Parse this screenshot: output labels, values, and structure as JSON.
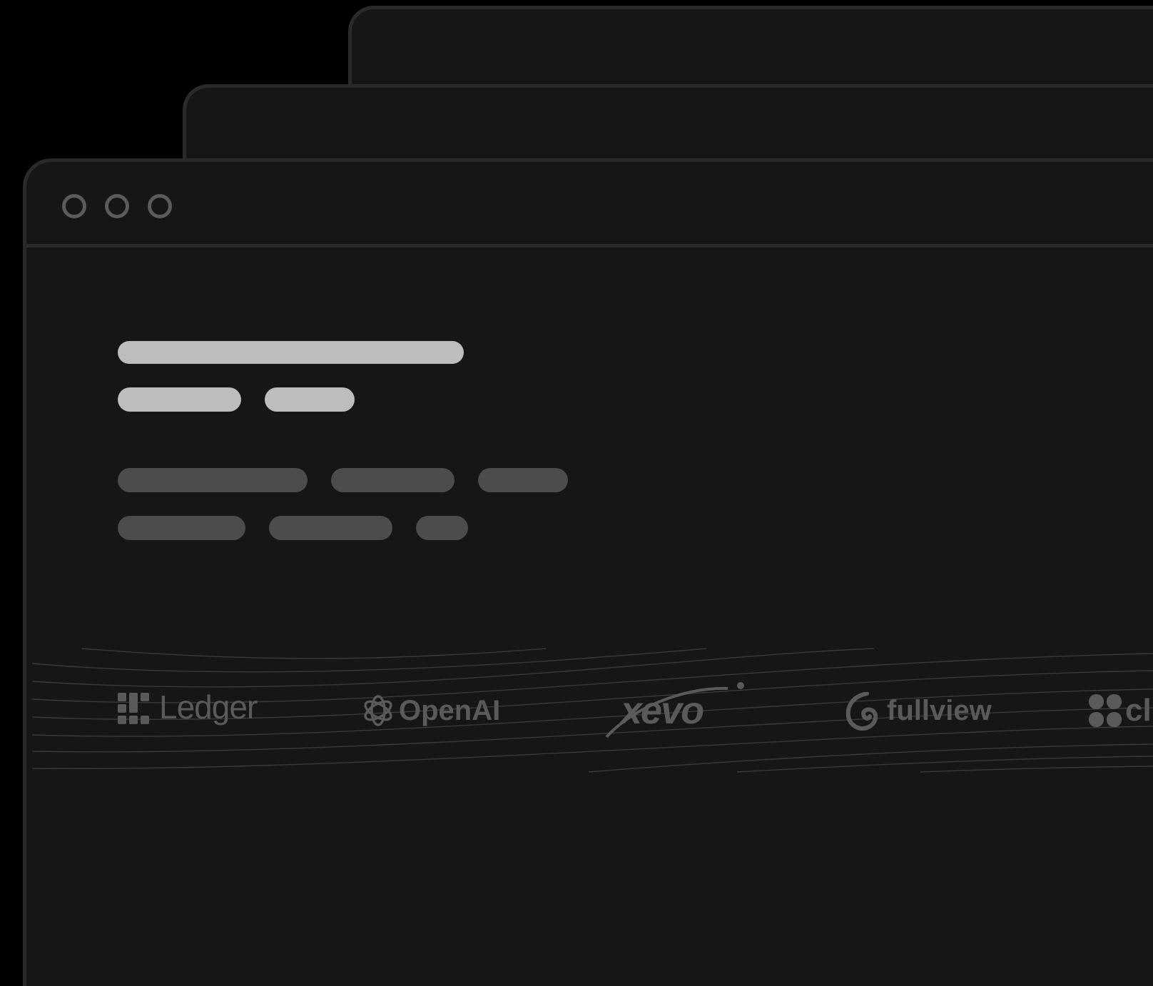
{
  "window": {
    "titlebar_dots": [
      "close-dot",
      "minimize-dot",
      "maximize-dot"
    ]
  },
  "logos": [
    {
      "name": "Ledger",
      "label": "Ledger",
      "icon": "ledger-grid-icon"
    },
    {
      "name": "OpenAI",
      "label": "OpenAI",
      "icon": "openai-knot-icon"
    },
    {
      "name": "Xevo",
      "label": "xevo",
      "icon": "xevo-swoosh-icon"
    },
    {
      "name": "Fullview",
      "label": "fullview",
      "icon": "fullview-swirl-icon"
    },
    {
      "name": "Clover",
      "label": "cl",
      "icon": "clover-icon"
    }
  ],
  "colors": {
    "background": "#000000",
    "window_fill": "#161616",
    "window_border": "#2a2a2a",
    "dot_border": "#5b5b5b",
    "skeleton_light": "#bdbdbd",
    "skeleton_dark": "#4c4c4c",
    "logo": "#5a5a5a"
  }
}
